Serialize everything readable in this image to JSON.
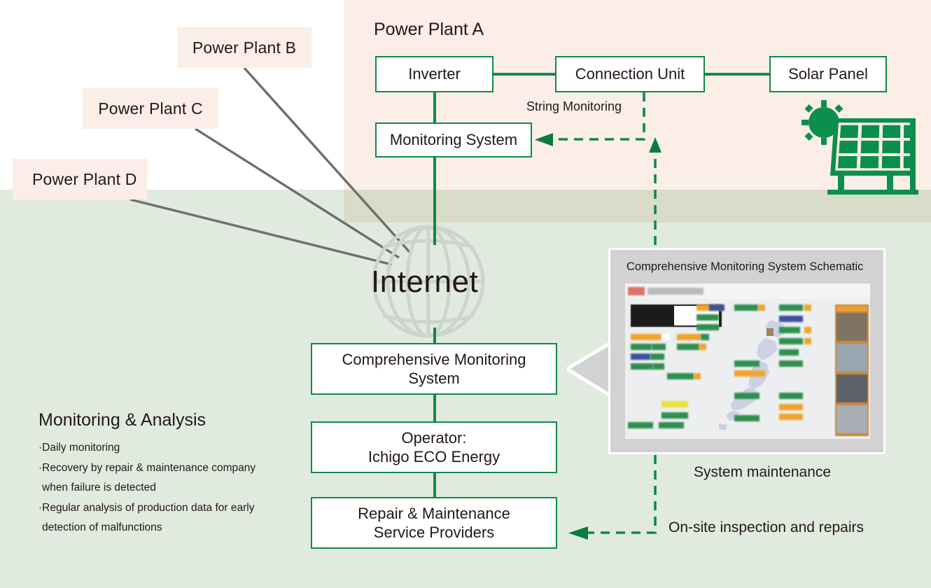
{
  "colors": {
    "green_line": "#0f8a46",
    "dark_green": "#0a7c3e",
    "pink_panel": "#faeee7",
    "green_panel": "#e1eadf",
    "overlap": "#d9dcc8",
    "gray_panel": "#d2d2d2",
    "connector_gray": "#6e6e6e",
    "text": "#231815"
  },
  "site": {
    "plant_a_title": "Power Plant A",
    "plants": [
      {
        "id": "plant-b",
        "label": "Power Plant B"
      },
      {
        "id": "plant-c",
        "label": "Power Plant C"
      },
      {
        "id": "plant-d",
        "label": "Power Plant D"
      }
    ]
  },
  "nodes": {
    "inverter": "Inverter",
    "connection_unit": "Connection Unit",
    "solar_panel": "Solar Panel",
    "monitoring_system": "Monitoring System",
    "comprehensive_monitoring_system": "Comprehensive Monitoring\nSystem",
    "operator": "Operator:\nIchigo ECO Energy",
    "repair": "Repair & Maintenance\nService Providers"
  },
  "labels": {
    "string_monitoring": "String Monitoring",
    "internet": "Internet",
    "on_site": "On-site inspection and repairs",
    "system_maintenance": "System maintenance",
    "schematic_caption": "Comprehensive Monitoring System Schematic"
  },
  "monitoring_analysis": {
    "title": "Monitoring & Analysis",
    "bullets": [
      {
        "text": "·Daily monitoring",
        "continuation": null
      },
      {
        "text": "·Recovery by repair & maintenance company",
        "continuation": "when failure is detected"
      },
      {
        "text": "·Regular analysis of production data for early",
        "continuation": "detection of malfunctions"
      }
    ]
  }
}
